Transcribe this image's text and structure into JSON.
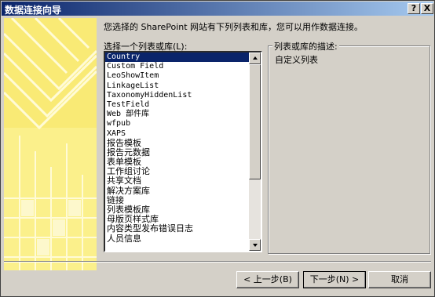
{
  "window": {
    "title": "数据连接向导",
    "help_label": "?",
    "close_label": "X"
  },
  "prompt": "您选择的 SharePoint 网站有下列列表和库，您可以用作数据连接。",
  "list_label": "选择一个列表或库(L):",
  "list_items": [
    "Country",
    "Custom Field",
    "LeoShowItem",
    "LinkageList",
    "TaxonomyHiddenList",
    "TestField",
    "Web 部件库",
    "wfpub",
    "XAPS",
    "报告模板",
    "报告元数据",
    "表单模板",
    "工作组讨论",
    "共享文档",
    "解决方案库",
    "链接",
    "列表模板库",
    "母版页样式库",
    "内容类型发布错误日志",
    "人员信息"
  ],
  "selected_item": "Country",
  "description_title": "列表或库的描述:",
  "description_text": "自定义列表",
  "buttons": {
    "back": "< 上一步(B)",
    "next": "下一步(N) >",
    "cancel": "取消"
  },
  "colors": {
    "title_bar": "#0a246a",
    "banner": "#fbf08b",
    "selection": "#0a246a"
  },
  "icons": {
    "scroll_up": "triangle-up",
    "scroll_down": "triangle-down"
  }
}
